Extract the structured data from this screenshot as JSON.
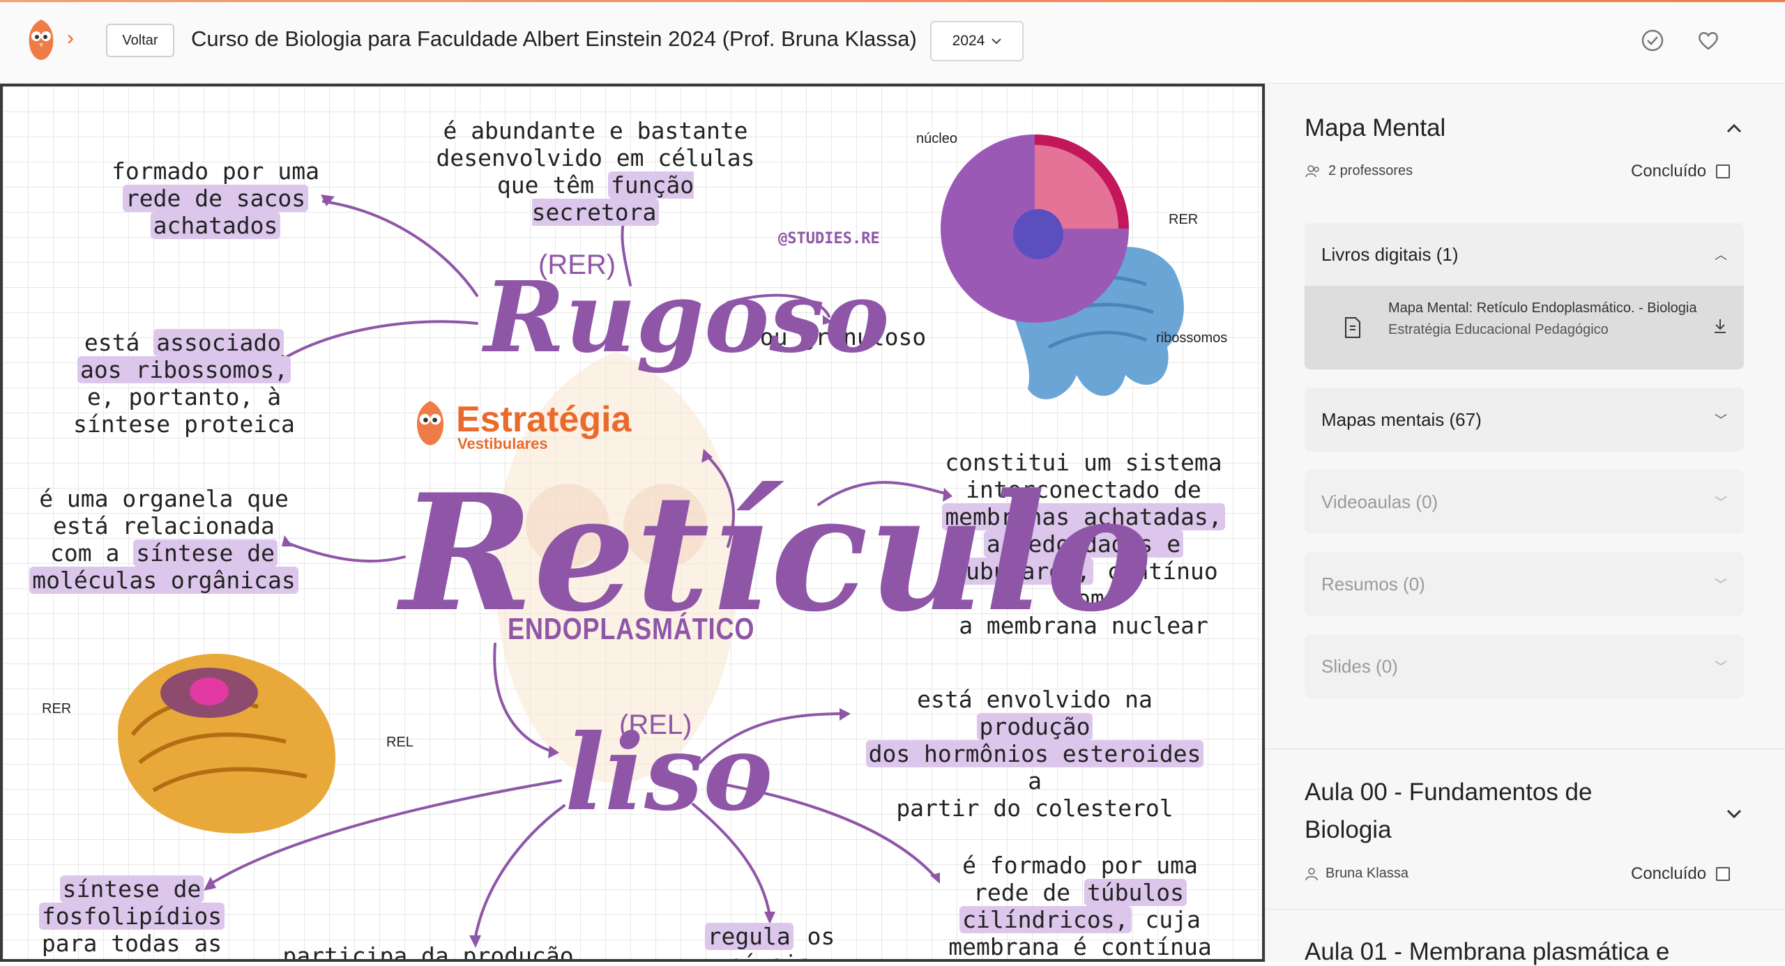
{
  "header": {
    "back_label": "Voltar",
    "course_title": "Curso de Biologia para Faculdade Albert Einstein 2024 (Prof. Bruna Klassa)",
    "year_selected": "2024",
    "icons": [
      "owl-logo",
      "chevron-right-icon",
      "check-circle-icon",
      "heart-icon"
    ],
    "accent_color": "#ef7c47"
  },
  "mindmap": {
    "watermark": "@STUDIES.RE",
    "brand_name": "Estratégia",
    "brand_sub": "Vestibulares",
    "center_word": "Retículo",
    "center_sub": "ENDOPLASMÁTICO",
    "rugoso_tag": "(RER)",
    "rugoso_word": "Rugoso",
    "liso_tag": "(REL)",
    "liso_word": "liso",
    "nucleus_labels": {
      "nucleo": "núcleo",
      "rer": "RER",
      "ribossomos": "ribossomos"
    },
    "organelle_labels": {
      "rer": "RER",
      "rel": "REL"
    },
    "notes": {
      "n1": "formado por uma\nrede de sacos\nachatados",
      "n2": "é abundante e bastante\ndesenvolvido em células\nque têm função secretora",
      "n3": "ou granuloso",
      "n4": "está associado\naos ribossomos,\ne, portanto, à\nsíntese proteica",
      "n5": "é uma organela que\nestá relacionada\ncom a síntese de\nmoléculas orgânicas",
      "n6": "constitui um sistema\ninterconectado de\nmembranas achatadas,\narredondadas e\ntubulares, contínuo com\na membrana nuclear",
      "n7": "está envolvido na produção\ndos hormônios esteroides a\npartir do colesterol",
      "n8": "síntese de\nfosfolipídios\npara todas as",
      "n9": "participa da produção",
      "n10": "regula os níveis",
      "n11": "é formado por uma\nrede de túbulos\ncilíndricos, cuja\nmembrana é contínua"
    },
    "accent_color": "#8f56a8",
    "highlight_color": "#dcc6ec"
  },
  "sidebar": {
    "mapa_title": "Mapa Mental",
    "professores": "2 professores",
    "concluido_label": "Concluído",
    "livros_label": "Livros digitais (1)",
    "book_title": "Mapa Mental: Retículo Endoplasmático. - Biologia",
    "book_author": "Estratégia Educacional Pedagógico",
    "mapas_label": "Mapas mentais (67)",
    "videoaulas_label": "Videoaulas (0)",
    "resumos_label": "Resumos (0)",
    "slides_label": "Slides (0)",
    "aula00_title": "Aula 00 - Fundamentos de Biologia",
    "aula00_prof": "Bruna Klassa",
    "aula01_title": "Aula 01 - Membrana plasmática e"
  }
}
